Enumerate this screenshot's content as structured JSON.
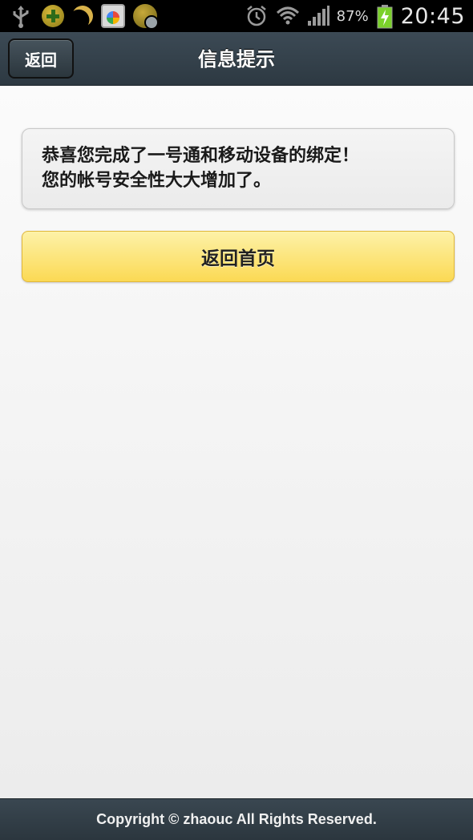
{
  "status_bar": {
    "left_icons": [
      "usb-icon",
      "plus-circle-icon",
      "moon-icon",
      "app-icon",
      "ball-check-icon"
    ],
    "right_icons": [
      "alarm-icon",
      "wifi-icon",
      "signal-icon",
      "battery-charging-icon"
    ],
    "battery_percent": "87%",
    "time": "20:45"
  },
  "header": {
    "back_label": "返回",
    "title": "信息提示"
  },
  "message": {
    "line1": "恭喜您完成了一号通和移动设备的绑定！",
    "line2": "您的帐号安全性大大增加了。"
  },
  "home_button": {
    "label": "返回首页"
  },
  "footer": {
    "copyright": "Copyright © zhaouc All Rights Reserved."
  },
  "colors": {
    "header_bg": "#34414b",
    "button_yellow": "#fbd954",
    "page_bg": "#f2f2f2",
    "battery_green": "#7bd12b"
  }
}
